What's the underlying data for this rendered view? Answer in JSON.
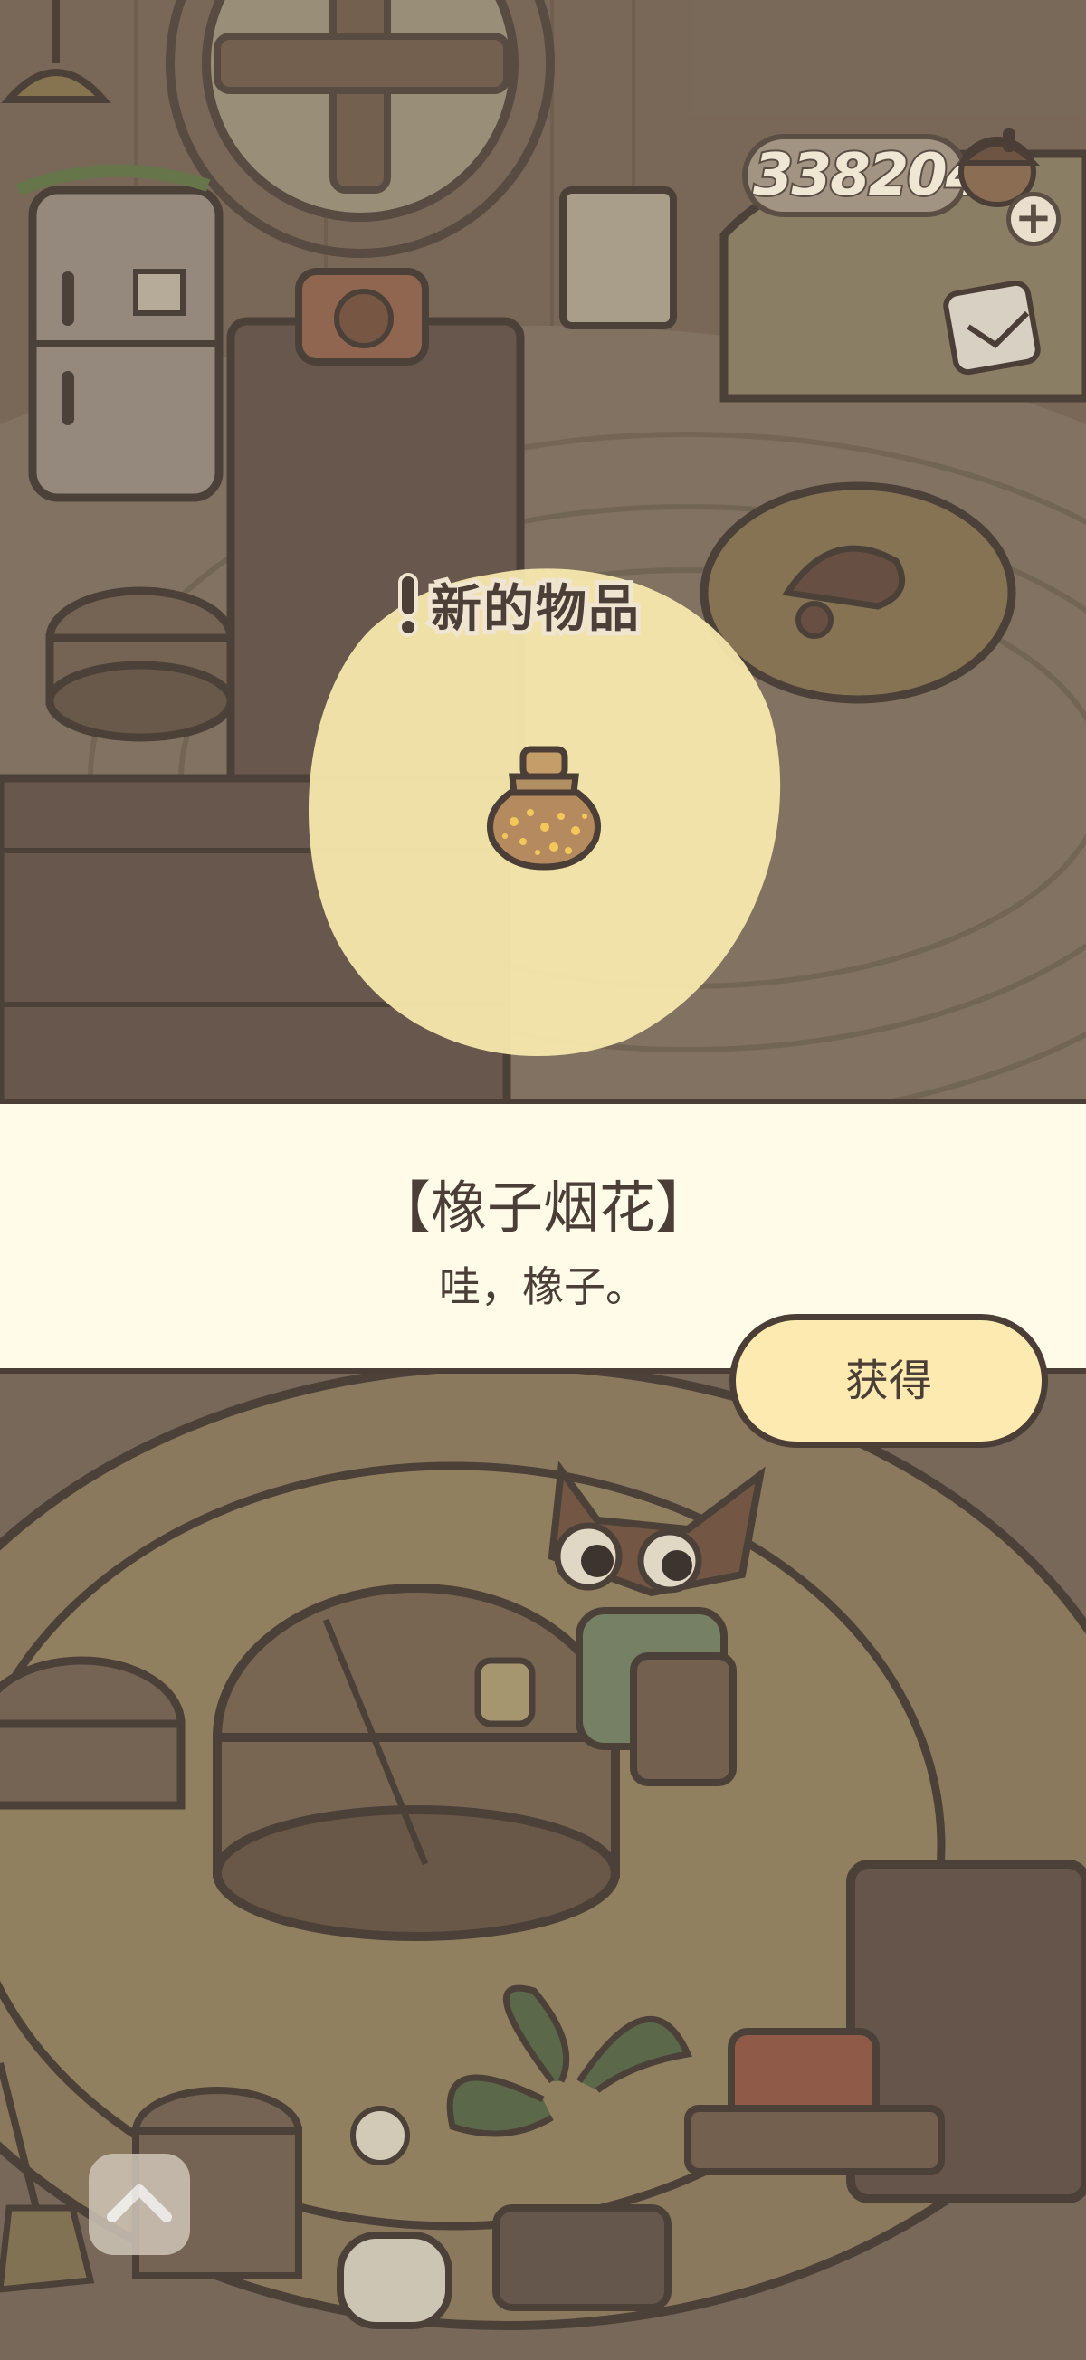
{
  "hud": {
    "coin_count": "338204",
    "add_coins_symbol": "+"
  },
  "popup": {
    "header_title": "新的物品",
    "item_name": "【橡子烟花】",
    "item_description": "哇，橡子。",
    "obtain_label": "获得"
  },
  "icons": {
    "exclaim": "exclamation-icon",
    "item": "acorn-firework-jar-icon",
    "up": "chevron-up-icon",
    "coin": "acorn-coin-icon",
    "clipboard": "clipboard-icon"
  },
  "colors": {
    "spotlight": "#f6e8ac",
    "dialog_bg": "#fffbe8",
    "button_bg": "#fdeab0",
    "outline": "#4a3e37"
  }
}
